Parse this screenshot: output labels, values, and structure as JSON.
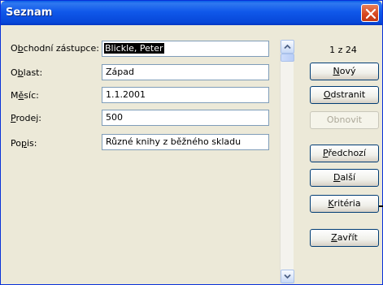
{
  "window": {
    "title": "Seznam"
  },
  "fields": [
    {
      "label": "Obchodní zástupce",
      "value": "Blickle, Peter"
    },
    {
      "label": "Oblast",
      "value": "Západ"
    },
    {
      "label": "Měsíc",
      "value": "1.1.2001"
    },
    {
      "label": "Prodej",
      "value": "500"
    },
    {
      "label": "Popis",
      "value": "Různé knihy z běžného skladu"
    }
  ],
  "record_counter": "1 z 24",
  "buttons": {
    "new": "Nový",
    "delete": "Odstranit",
    "restore": "Obnovit",
    "previous": "Předchozí",
    "next": "Další",
    "criteria": "Kritéria",
    "close": "Zavřít"
  },
  "icons": {
    "close": "close-icon",
    "scroll_up": "chevron-up-icon",
    "scroll_down": "chevron-down-icon"
  }
}
